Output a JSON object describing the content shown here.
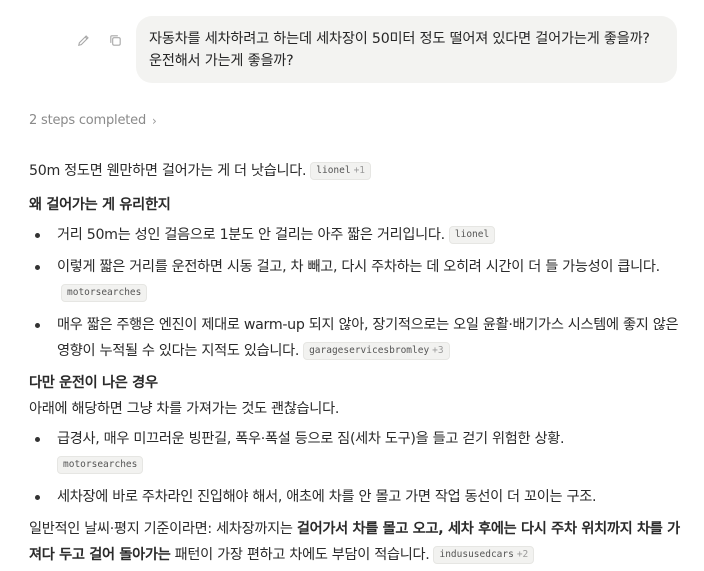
{
  "user_message": {
    "text": "자동차를 세차하려고 하는데 세차장이 50미터 정도 떨어져 있다면 걸어가는게 좋을까? 운전해서 가는게 좋을까?",
    "edit_icon": "pencil-icon",
    "copy_icon": "copy-icon"
  },
  "steps": {
    "label": "2 steps completed",
    "chevron": "›"
  },
  "answer": {
    "intro": {
      "text": "50m 정도면 웬만하면 걸어가는 게 더 낫습니다.",
      "cite": "lionel",
      "cite_more": "+1"
    },
    "section1": {
      "heading": "왜 걸어가는 게 유리한지",
      "items": [
        {
          "text": "거리 50m는 성인 걸음으로 1분도 안 걸리는 아주 짧은 거리입니다.",
          "cite": "lionel",
          "cite_more": ""
        },
        {
          "text": "이렇게 짧은 거리를 운전하면 시동 걸고, 차 빼고, 다시 주차하는 데 오히려 시간이 더 들 가능성이 큽니다.",
          "cite": "motorsearches",
          "cite_more": ""
        },
        {
          "text": "매우 짧은 주행은 엔진이 제대로 warm-up 되지 않아, 장기적으로는 오일 윤활·배기가스 시스템에 좋지 않은 영향이 누적될 수 있다는 지적도 있습니다.",
          "cite": "garageservicesbromley",
          "cite_more": "+3"
        }
      ]
    },
    "section2": {
      "heading": "다만 운전이 나은 경우",
      "lead": "아래에 해당하면 그냥 차를 가져가는 것도 괜찮습니다.",
      "items": [
        {
          "text": "급경사, 매우 미끄러운 빙판길, 폭우·폭설 등으로 짐(세차 도구)을 들고 걷기 위험한 상황.",
          "cite": "motorsearches",
          "cite_more": ""
        },
        {
          "text": "세차장에 바로 주차라인 진입해야 해서, 애초에 차를 안 몰고 가면 작업 동선이 더 꼬이는 구조.",
          "cite": "",
          "cite_more": ""
        }
      ]
    },
    "conclusion": {
      "prefix": "일반적인 날씨·평지 기준이라면: 세차장까지는 ",
      "bold": "걸어가서 차를 몰고 오고, 세차 후에는 다시 주차 위치까지 차를 가져다 두고 걸어 돌아가는",
      "suffix": " 패턴이 가장 편하고 차에도 부담이 적습니다.",
      "cite": "indususedcars",
      "cite_more": "+2"
    }
  }
}
